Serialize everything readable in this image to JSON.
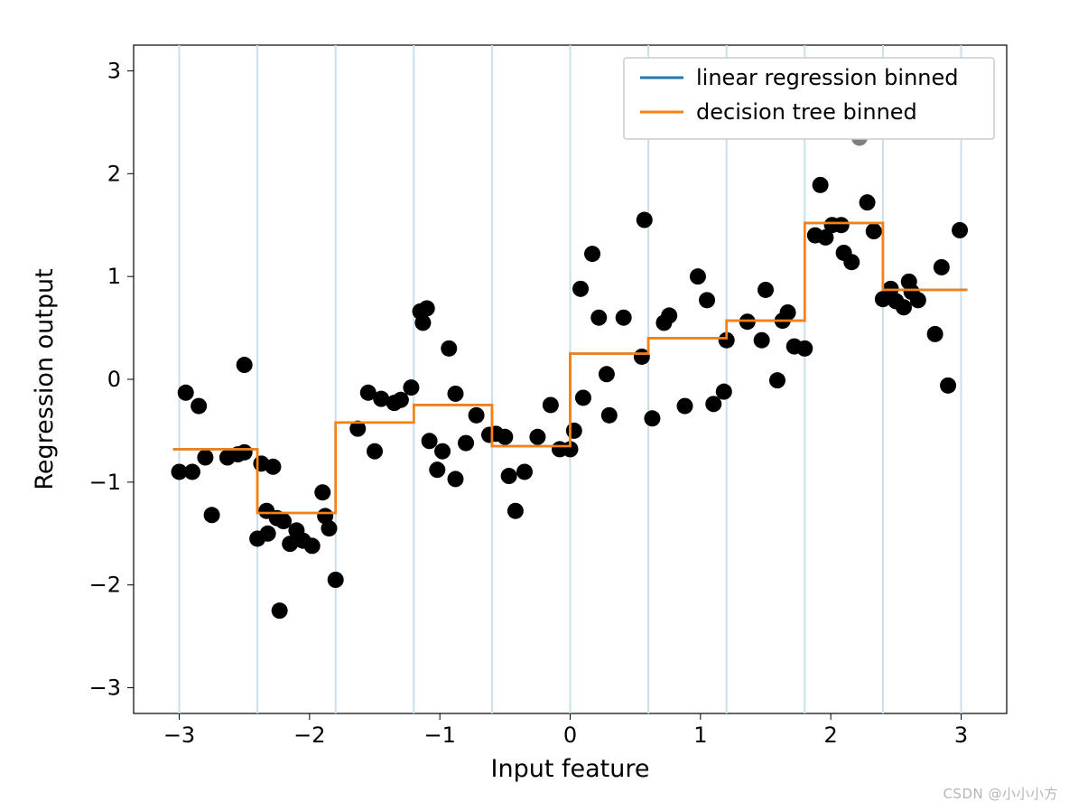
{
  "chart_data": {
    "type": "scatter",
    "xlabel": "Input feature",
    "ylabel": "Regression output",
    "xlim": [
      -3.35,
      3.35
    ],
    "ylim": [
      -3.25,
      3.25
    ],
    "xticks": [
      -3,
      -2,
      -1,
      0,
      1,
      2,
      3
    ],
    "yticks": [
      -3,
      -2,
      -1,
      0,
      1,
      2,
      3
    ],
    "bin_edges": [
      -3.0,
      -2.4,
      -1.8,
      -1.2,
      -0.6,
      0.0,
      0.6,
      1.2,
      1.8,
      2.4,
      3.0
    ],
    "series": [
      {
        "name": "linear regression binned",
        "type": "step",
        "color": "#1f77b4",
        "values": [
          -0.68,
          -1.3,
          -0.42,
          -0.25,
          -0.65,
          0.25,
          0.4,
          0.57,
          1.52,
          0.87
        ]
      },
      {
        "name": "decision tree binned",
        "type": "step",
        "color": "#ff7f0e",
        "values": [
          -0.68,
          -1.3,
          -0.42,
          -0.25,
          -0.65,
          0.25,
          0.4,
          0.57,
          1.52,
          0.87
        ]
      }
    ],
    "scatter": {
      "color": "#000000",
      "gray_point": {
        "x": 2.22,
        "y": 2.35
      },
      "points": [
        [
          -3.0,
          -0.9
        ],
        [
          -2.95,
          -0.13
        ],
        [
          -2.9,
          -0.9
        ],
        [
          -2.85,
          -0.26
        ],
        [
          -2.8,
          -0.76
        ],
        [
          -2.75,
          -1.32
        ],
        [
          -2.63,
          -0.76
        ],
        [
          -2.55,
          -0.73
        ],
        [
          -2.5,
          0.14
        ],
        [
          -2.5,
          -0.71
        ],
        [
          -2.4,
          -1.55
        ],
        [
          -2.37,
          -0.82
        ],
        [
          -2.33,
          -1.28
        ],
        [
          -2.32,
          -1.5
        ],
        [
          -2.28,
          -0.85
        ],
        [
          -2.25,
          -1.35
        ],
        [
          -2.23,
          -2.25
        ],
        [
          -2.2,
          -1.38
        ],
        [
          -2.15,
          -1.6
        ],
        [
          -2.1,
          -1.47
        ],
        [
          -2.05,
          -1.57
        ],
        [
          -1.98,
          -1.62
        ],
        [
          -1.9,
          -1.1
        ],
        [
          -1.88,
          -1.33
        ],
        [
          -1.85,
          -1.45
        ],
        [
          -1.8,
          -1.95
        ],
        [
          -1.63,
          -0.48
        ],
        [
          -1.55,
          -0.13
        ],
        [
          -1.5,
          -0.7
        ],
        [
          -1.45,
          -0.19
        ],
        [
          -1.35,
          -0.23
        ],
        [
          -1.3,
          -0.2
        ],
        [
          -1.22,
          -0.08
        ],
        [
          -1.15,
          0.66
        ],
        [
          -1.1,
          0.69
        ],
        [
          -1.13,
          0.55
        ],
        [
          -1.08,
          -0.6
        ],
        [
          -1.02,
          -0.88
        ],
        [
          -0.98,
          -0.7
        ],
        [
          -0.93,
          0.3
        ],
        [
          -0.88,
          -0.97
        ],
        [
          -0.88,
          -0.14
        ],
        [
          -0.8,
          -0.62
        ],
        [
          -0.72,
          -0.35
        ],
        [
          -0.62,
          -0.54
        ],
        [
          -0.57,
          -0.53
        ],
        [
          -0.5,
          -0.56
        ],
        [
          -0.47,
          -0.94
        ],
        [
          -0.42,
          -1.28
        ],
        [
          -0.35,
          -0.9
        ],
        [
          -0.25,
          -0.56
        ],
        [
          -0.15,
          -0.25
        ],
        [
          -0.08,
          -0.68
        ],
        [
          0.0,
          -0.68
        ],
        [
          0.03,
          -0.5
        ],
        [
          0.08,
          0.88
        ],
        [
          0.1,
          -0.18
        ],
        [
          0.17,
          1.22
        ],
        [
          0.22,
          0.6
        ],
        [
          0.28,
          0.05
        ],
        [
          0.3,
          -0.35
        ],
        [
          0.41,
          0.6
        ],
        [
          0.55,
          0.22
        ],
        [
          0.57,
          1.55
        ],
        [
          0.63,
          -0.38
        ],
        [
          0.72,
          0.55
        ],
        [
          0.76,
          0.62
        ],
        [
          0.88,
          -0.26
        ],
        [
          0.98,
          1.0
        ],
        [
          1.05,
          0.77
        ],
        [
          1.1,
          -0.24
        ],
        [
          1.18,
          -0.12
        ],
        [
          1.2,
          0.38
        ],
        [
          1.36,
          0.56
        ],
        [
          1.47,
          0.38
        ],
        [
          1.5,
          0.87
        ],
        [
          1.59,
          -0.01
        ],
        [
          1.63,
          0.57
        ],
        [
          1.67,
          0.65
        ],
        [
          1.72,
          0.32
        ],
        [
          1.8,
          0.3
        ],
        [
          1.88,
          1.4
        ],
        [
          1.92,
          1.89
        ],
        [
          1.96,
          1.38
        ],
        [
          2.01,
          1.5
        ],
        [
          2.08,
          1.5
        ],
        [
          2.1,
          1.23
        ],
        [
          2.16,
          1.14
        ],
        [
          2.28,
          1.72
        ],
        [
          2.33,
          1.44
        ],
        [
          2.4,
          0.78
        ],
        [
          2.46,
          0.88
        ],
        [
          2.5,
          0.76
        ],
        [
          2.56,
          0.7
        ],
        [
          2.6,
          0.95
        ],
        [
          2.62,
          0.85
        ],
        [
          2.67,
          0.77
        ],
        [
          2.8,
          0.44
        ],
        [
          2.85,
          1.09
        ],
        [
          2.9,
          -0.06
        ],
        [
          2.99,
          1.45
        ]
      ]
    },
    "legend": {
      "position": "upper right",
      "items": [
        "linear regression binned",
        "decision tree binned"
      ]
    },
    "watermark": "CSDN @小小小方"
  }
}
